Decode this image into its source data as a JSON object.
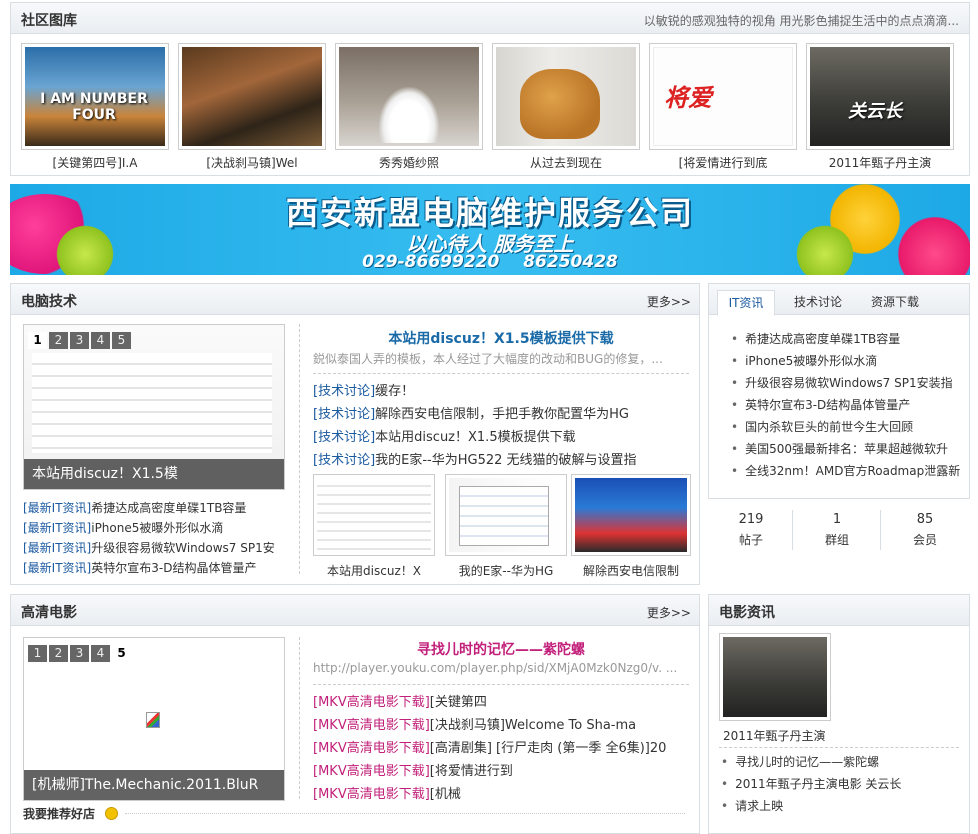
{
  "gallery": {
    "title": "社区图库",
    "slogan": "以敏锐的感观独特的视角 用光影色捕捉生活中的点点滴滴...",
    "items": [
      {
        "caption": "[关键第四号]I.A",
        "poster_text": "I AM NUMBER FOUR"
      },
      {
        "caption": "[决战刹马镇]Wel",
        "poster_text": ""
      },
      {
        "caption": "秀秀婚纱照",
        "poster_text": ""
      },
      {
        "caption": "从过去到现在",
        "poster_text": ""
      },
      {
        "caption": "[将爱情进行到底",
        "poster_text": "将爱"
      },
      {
        "caption": "2011年甄子丹主演",
        "poster_text": "关云长"
      }
    ]
  },
  "banner": {
    "title": "西安新盟电脑维护服务公司",
    "subtitle": "以心待人   服务至上",
    "phones": "029-86699220 86250428"
  },
  "tech": {
    "title": "电脑技术",
    "more": "更多>>",
    "slide_numbers": [
      "1",
      "2",
      "3",
      "4",
      "5"
    ],
    "slide_active": 0,
    "slide_caption": "本站用discuz！X1.5模",
    "news": [
      {
        "tag": "[最新IT资讯]",
        "text": "希捷达成高密度单碟1TB容量"
      },
      {
        "tag": "[最新IT资讯]",
        "text": "iPhone5被曝外形似水滴"
      },
      {
        "tag": "[最新IT资讯]",
        "text": "升级很容易微软Windows7 SP1安"
      },
      {
        "tag": "[最新IT资讯]",
        "text": "英特尔宣布3-D结构晶体管量产"
      }
    ],
    "featured_title": "本站用discuz！X1.5模板提供下载",
    "featured_desc": "鋭似泰国人弄的模板，本人经过了大幅度的改动和BUG的修复，...",
    "discuss": [
      {
        "tag": "[技术讨论]",
        "text": "缓存！"
      },
      {
        "tag": "[技术讨论]",
        "text": "解除西安电信限制，手把手教你配置华为HG"
      },
      {
        "tag": "[技术讨论]",
        "text": "本站用discuz！X1.5模板提供下载"
      },
      {
        "tag": "[技术讨论]",
        "text": "我的E家--华为HG522 无线猫的破解与设置指"
      }
    ],
    "thumbs": [
      "本站用discuz！X",
      "我的E家--华为HG",
      "解除西安电信限制"
    ]
  },
  "sidebar": {
    "tabs": [
      "IT资讯",
      "技术讨论",
      "资源下载"
    ],
    "active_tab": 0,
    "items": [
      "希捷达成高密度单碟1TB容量",
      "iPhone5被曝外形似水滴",
      "升级很容易微软Windows7 SP1安装指",
      "英特尔宣布3-D结构晶体管量产",
      "国内杀软巨头的前世今生大回顾",
      "美国500强最新排名：苹果超越微软升",
      "全线32nm！AMD官方Roadmap泄露新"
    ],
    "stats": [
      {
        "value": "219",
        "label": "帖子"
      },
      {
        "value": "1",
        "label": "群组"
      },
      {
        "value": "85",
        "label": "会员"
      }
    ]
  },
  "movie": {
    "title": "高清电影",
    "more": "更多>>",
    "slide_numbers": [
      "1",
      "2",
      "3",
      "4",
      "5"
    ],
    "slide_active": 4,
    "slide_caption": "[机械师]The.Mechanic.2011.BluR",
    "featured_title": "寻找儿时的记忆——紫陀螺",
    "featured_desc": "http://player.youku.com/player.php/sid/XMjA0Mzk0Nzg0/v. ...",
    "list": [
      {
        "tag": "[MKV高清电影下载]",
        "text": "[关键第四"
      },
      {
        "tag": "[MKV高清电影下载]",
        "text": "[决战刹马镇]Welcome To Sha-ma"
      },
      {
        "tag": "[MKV高清电影下载]",
        "text": "[高清剧集] [行尸走肉 (第一季 全6集)]20"
      },
      {
        "tag": "[MKV高清电影下载]",
        "text": "[将爱情进行到"
      },
      {
        "tag": "[MKV高清电影下载]",
        "text": "[机械"
      }
    ],
    "recommend": "我要推荐好店"
  },
  "movienews": {
    "title": "电影资讯",
    "poster_caption": "2011年甄子丹主演",
    "items": [
      "寻找儿时的记忆——紫陀螺",
      "2011年甄子丹主演电影 关云长",
      "请求上映"
    ]
  }
}
